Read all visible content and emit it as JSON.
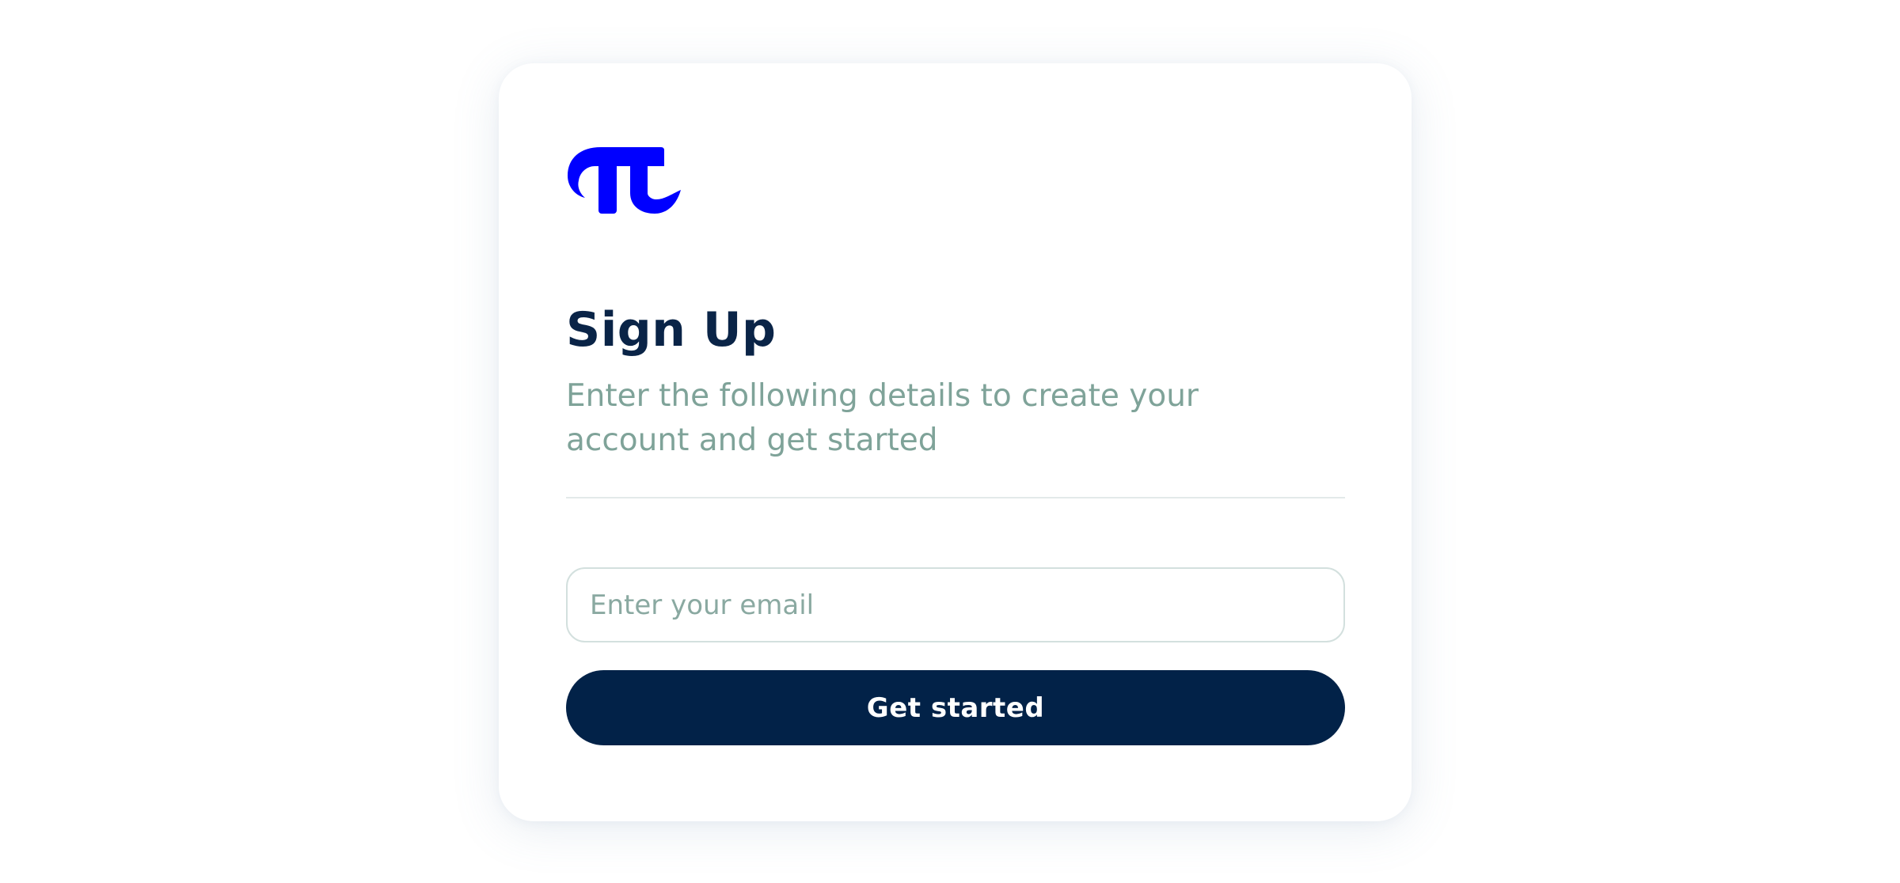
{
  "brand": {
    "logo_icon": "pi-logo-icon",
    "color": "#0000ff"
  },
  "signup": {
    "title": "Sign Up",
    "subtitle": "Enter the following details to create your account and get started",
    "email_placeholder": "Enter your email",
    "email_value": "",
    "button_label": "Get started"
  },
  "colors": {
    "title": "#0a2447",
    "subtitle": "#7fa399",
    "button_bg": "#022248",
    "button_text": "#ffffff"
  }
}
